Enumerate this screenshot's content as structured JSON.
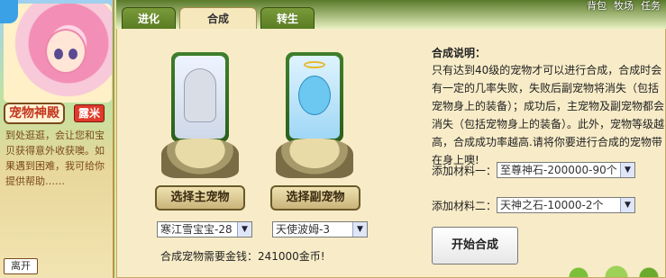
{
  "npc": {
    "title": "宠物神殿",
    "name": "露米",
    "description": "到处逛逛，会让您和宝贝获得意外收获噢。如果遇到困难，我可给你提供帮助……",
    "leave_label": "离开"
  },
  "top_links": [
    "背包",
    "牧场",
    "任务"
  ],
  "tabs": [
    {
      "label": "进化",
      "active": false
    },
    {
      "label": "合成",
      "active": true
    },
    {
      "label": "转生",
      "active": false
    }
  ],
  "synthesis": {
    "main_pet_button": "选择主宠物",
    "sub_pet_button": "选择副宠物",
    "main_pet_selected": "寒江雪宝宝-28",
    "sub_pet_selected": "天使波姆-3",
    "cost_text": "合成宠物需要金钱：241000金币!"
  },
  "info": {
    "title": "合成说明：",
    "body": "只有达到40级的宠物才可以进行合成，合成时会有一定的几率失败，失败后副宠物将消失（包括宠物身上的装备）；成功后，主宠物及副宠物都会消失（包括宠物身上的装备）。此外，宠物等级越高，合成成功率越高.请将你要进行合成的宠物带在身上噢!"
  },
  "materials": [
    {
      "label": "添加材料一：",
      "selected": "至尊神石-200000-90个"
    },
    {
      "label": "添加材料二：",
      "selected": "天神之石-10000-2个"
    }
  ],
  "start_button": "开始合成",
  "colors": {
    "panel_bg": "#f8ecc8",
    "tab_green": "#567a20",
    "npc_name_red": "#e03a2a"
  }
}
